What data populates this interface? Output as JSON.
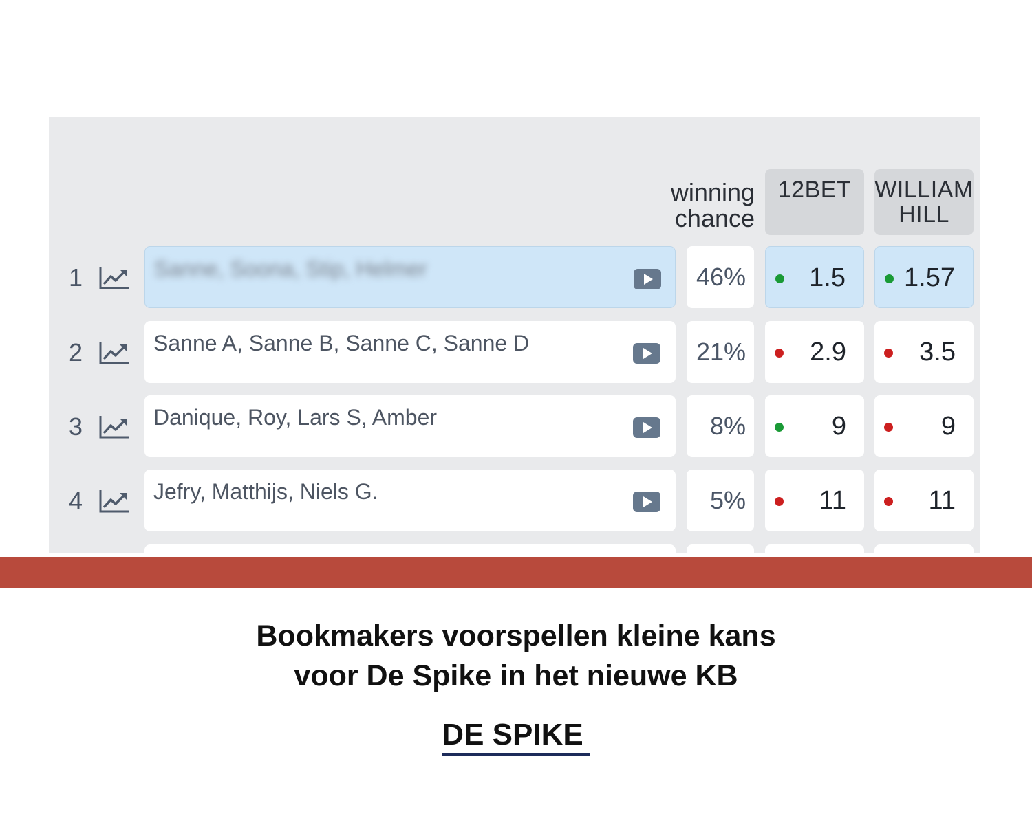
{
  "header": {
    "chance_line1": "winning",
    "chance_line2": "chance",
    "bookmaker1": "12BET",
    "bookmaker2_line1": "WILLIAM",
    "bookmaker2_line2": "HILL"
  },
  "colors": {
    "up": "#1a9a36",
    "down": "#cc1f1f",
    "highlight": "#cfe6f8",
    "band": "#b84a3c"
  },
  "rows": [
    {
      "rank": "1",
      "names": "Sanne, Soona, Stip, Helmer",
      "blurred": true,
      "chance": "46%",
      "odds_12bet": "1.5",
      "trend_12bet": "up",
      "odds_wh": "1.57",
      "trend_wh": "up"
    },
    {
      "rank": "2",
      "names": "Sanne A, Sanne B, Sanne C, Sanne D",
      "blurred": false,
      "chance": "21%",
      "odds_12bet": "2.9",
      "trend_12bet": "down",
      "odds_wh": "3.5",
      "trend_wh": "down"
    },
    {
      "rank": "3",
      "names": "Danique, Roy, Lars S, Amber",
      "blurred": false,
      "chance": "8%",
      "odds_12bet": "9",
      "trend_12bet": "up",
      "odds_wh": "9",
      "trend_wh": "down"
    },
    {
      "rank": "4",
      "names": "Jefry, Matthijs, Niels G.",
      "blurred": false,
      "chance": "5%",
      "odds_12bet": "11",
      "trend_12bet": "down",
      "odds_wh": "11",
      "trend_wh": "down"
    }
  ],
  "icons": {
    "trend": "trending-up-icon",
    "play": "play-icon"
  },
  "caption": {
    "line1": "Bookmakers voorspellen kleine kans",
    "line2": "voor De Spike in het nieuwe KB"
  },
  "brand": "DE SPIKE"
}
